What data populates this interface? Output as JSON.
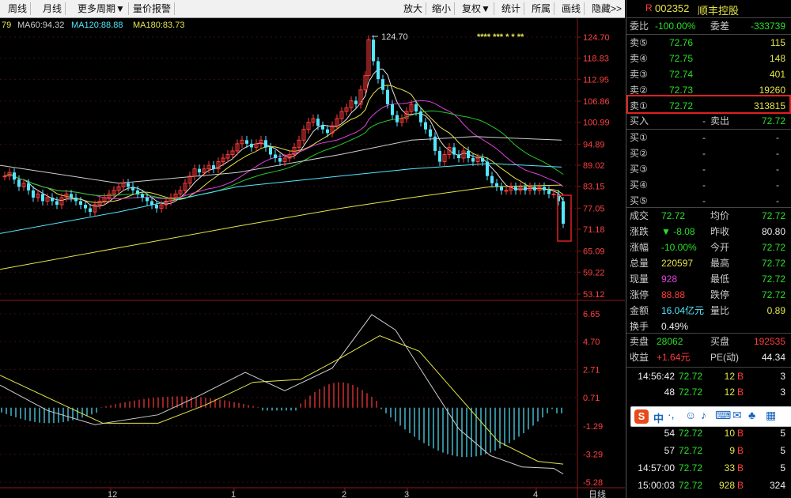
{
  "toolbar": {
    "left": [
      "周线",
      "月线",
      "更多周期▼",
      "量价报警"
    ],
    "right": [
      "放大",
      "缩小",
      "复权▼",
      "统计",
      "所属",
      "画线",
      "隐藏>>"
    ]
  },
  "ma_legend": [
    {
      "text": "79",
      "color": "#e5e54a"
    },
    {
      "text": "MA60:94.32",
      "color": "#cfcfcf"
    },
    {
      "text": "MA120:88.88",
      "color": "#55e6ff"
    },
    {
      "text": "MA180:83.73",
      "color": "#e5e54a"
    }
  ],
  "price_axis": [
    "124.70",
    "118.83",
    "112.95",
    "106.86",
    "100.99",
    "94.89",
    "89.02",
    "83.15",
    "77.05",
    "71.18",
    "65.09",
    "59.22",
    "53.12"
  ],
  "peak_label": "124.70",
  "stars": "**** *** * * **",
  "macd_axis": [
    "6.65",
    "4.70",
    "2.71",
    "0.71",
    "-1.29",
    "-3.29",
    "-5.28"
  ],
  "date_axis": [
    "12",
    "1",
    "2",
    "3",
    "4",
    "日线"
  ],
  "stock": {
    "code": "002352",
    "name": "顺丰控股",
    "flag": "R"
  },
  "ratio": {
    "label1": "委比",
    "value1": "-100.00%",
    "label2": "委差",
    "value2": "-333739"
  },
  "asks": [
    {
      "label": "卖⑤",
      "price": "72.76",
      "vol": "115"
    },
    {
      "label": "卖④",
      "price": "72.75",
      "vol": "148"
    },
    {
      "label": "卖③",
      "price": "72.74",
      "vol": "401"
    },
    {
      "label": "卖②",
      "price": "72.73",
      "vol": "19260"
    },
    {
      "label": "卖①",
      "price": "72.72",
      "vol": "313815"
    }
  ],
  "buy_in": {
    "label": "买入",
    "value": "-",
    "label2": "卖出",
    "value2": "72.72"
  },
  "bids": [
    {
      "label": "买①",
      "price": "-",
      "vol": "-"
    },
    {
      "label": "买②",
      "price": "-",
      "vol": "-"
    },
    {
      "label": "买③",
      "price": "-",
      "vol": "-"
    },
    {
      "label": "买④",
      "price": "-",
      "vol": "-"
    },
    {
      "label": "买⑤",
      "price": "-",
      "vol": "-"
    }
  ],
  "stats": [
    {
      "l1": "成交",
      "v1": "72.72",
      "c1": "green",
      "l2": "均价",
      "v2": "72.72",
      "c2": "green"
    },
    {
      "l1": "涨跌",
      "v1": "▼ -8.08",
      "c1": "green",
      "l2": "昨收",
      "v2": "80.80",
      "c2": "white"
    },
    {
      "l1": "涨幅",
      "v1": "-10.00%",
      "c1": "green",
      "l2": "今开",
      "v2": "72.72",
      "c2": "green"
    },
    {
      "l1": "总量",
      "v1": "220597",
      "c1": "yellow",
      "l2": "最高",
      "v2": "72.72",
      "c2": "green"
    },
    {
      "l1": "现量",
      "v1": "928",
      "c1": "magenta",
      "l2": "最低",
      "v2": "72.72",
      "c2": "green"
    },
    {
      "l1": "涨停",
      "v1": "88.88",
      "c1": "red",
      "l2": "跌停",
      "v2": "72.72",
      "c2": "green"
    },
    {
      "l1": "金额",
      "v1": "16.04亿元",
      "c1": "cyan",
      "l2": "量比",
      "v2": "0.89",
      "c2": "yellow"
    },
    {
      "l1": "换手",
      "v1": "0.49%",
      "c1": "white",
      "l2": "",
      "v2": "",
      "c2": "white"
    }
  ],
  "pan": [
    {
      "l1": "卖盘",
      "v1": "28062",
      "c1": "green",
      "l2": "买盘",
      "v2": "192535",
      "c2": "red"
    },
    {
      "l1": "收益",
      "v1": "+1.64元",
      "c1": "red",
      "l2": "PE(动)",
      "v2": "44.34",
      "c2": "white"
    }
  ],
  "ticks": [
    {
      "time": "14:56:42",
      "price": "72.72",
      "vol": "12",
      "dir": "B",
      "n": "3"
    },
    {
      "time": "48",
      "price": "72.72",
      "vol": "12",
      "dir": "B",
      "n": "3"
    },
    {
      "time": "54",
      "price": "72.72",
      "vol": "10",
      "dir": "B",
      "n": "5"
    },
    {
      "time": "57",
      "price": "72.72",
      "vol": "9",
      "dir": "B",
      "n": "5"
    },
    {
      "time": "14:57:00",
      "price": "72.72",
      "vol": "33",
      "dir": "B",
      "n": "5"
    },
    {
      "time": "15:00:03",
      "price": "72.72",
      "vol": "928",
      "dir": "B",
      "n": "324"
    }
  ],
  "ime": {
    "logo": "S",
    "label": "中"
  },
  "colors": {
    "up": "#ff3b3b",
    "down": "#55e6ff",
    "highlight": "#e02020"
  }
}
